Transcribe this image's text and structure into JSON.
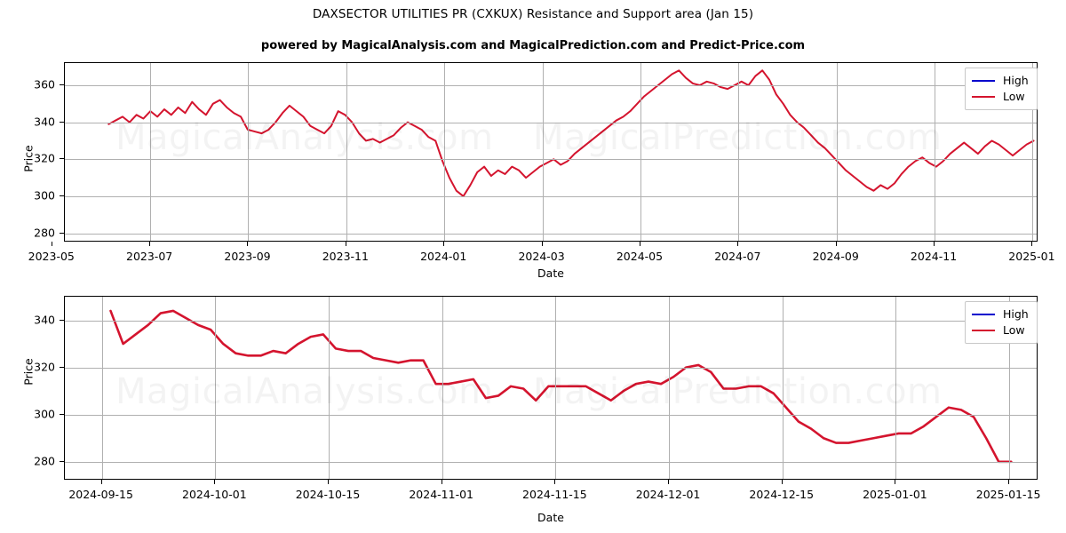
{
  "header": {
    "title": "DAXSECTOR UTILITIES PR (CXKUX) Resistance and Support area (Jan 15)",
    "subtitle": "powered by MagicalAnalysis.com and MagicalPrediction.com and Predict-Price.com"
  },
  "watermarks": [
    "MagicalAnalysis.com",
    "MagicalPrediction.com"
  ],
  "colors": {
    "high_series": "#0000cd",
    "low_series": "#d4142e",
    "grid": "#b0b0b0",
    "axis": "#000000",
    "background": "#ffffff"
  },
  "legend": {
    "position": "upper-right",
    "entries": [
      {
        "label": "High",
        "color": "#0000cd"
      },
      {
        "label": "Low",
        "color": "#d4142e"
      }
    ]
  },
  "chart_data": [
    {
      "id": "top-chart",
      "type": "line",
      "title": "",
      "xlabel": "Date",
      "ylabel": "Price",
      "grid": true,
      "legend_position": "upper-right",
      "xlim": [
        "2023-05-01",
        "2025-01-20"
      ],
      "ylim": [
        275,
        372
      ],
      "xticks": [
        "2023-05",
        "2023-07",
        "2023-09",
        "2023-11",
        "2024-01",
        "2024-03",
        "2024-05",
        "2024-07",
        "2024-09",
        "2024-11",
        "2025-01"
      ],
      "yticks": [
        280,
        300,
        320,
        340,
        360
      ],
      "series": [
        {
          "name": "High",
          "color": "#0000cd",
          "values": []
        },
        {
          "name": "Low",
          "color": "#d4142e",
          "x": [
            0.072,
            0.08,
            0.087,
            0.094,
            0.101,
            0.108,
            0.115,
            0.122,
            0.129,
            0.136,
            0.143,
            0.15,
            0.157,
            0.164,
            0.171,
            0.178,
            0.185,
            0.192,
            0.199,
            0.206,
            0.213,
            0.22,
            0.227,
            0.234,
            0.241,
            0.248,
            0.255,
            0.262,
            0.269,
            0.276,
            0.283,
            0.29,
            0.297,
            0.304,
            0.311,
            0.318,
            0.325,
            0.332,
            0.339,
            0.346,
            0.353,
            0.36,
            0.367,
            0.374,
            0.381,
            0.388,
            0.395,
            0.402,
            0.409,
            0.416,
            0.423,
            0.43,
            0.437,
            0.444,
            0.451,
            0.458,
            0.465,
            0.472,
            0.479,
            0.486,
            0.493,
            0.5,
            0.507,
            0.514,
            0.521,
            0.528,
            0.535,
            0.542,
            0.549,
            0.556,
            0.563,
            0.57,
            0.577,
            0.584,
            0.591,
            0.598,
            0.605,
            0.612,
            0.619,
            0.626,
            0.633,
            0.64,
            0.647,
            0.654,
            0.661,
            0.668,
            0.675,
            0.682,
            0.689,
            0.696,
            0.703,
            0.71,
            0.717,
            0.724,
            0.731,
            0.738,
            0.745,
            0.752,
            0.759,
            0.766,
            0.773,
            0.78,
            0.787,
            0.794,
            0.801,
            0.808,
            0.815,
            0.822,
            0.829,
            0.836,
            0.843,
            0.85,
            0.857,
            0.864,
            0.871,
            0.878,
            0.885,
            0.892,
            0.899,
            0.906,
            0.913,
            0.92,
            0.927,
            0.934,
            0.941,
            0.948,
            0.955,
            0.962,
            0.969,
            0.976,
            0.983,
            0.99,
            0.997
          ],
          "values": [
            339,
            341,
            343,
            340,
            344,
            342,
            346,
            343,
            347,
            344,
            348,
            345,
            351,
            347,
            344,
            350,
            352,
            348,
            345,
            343,
            336,
            335,
            334,
            336,
            340,
            345,
            349,
            346,
            343,
            338,
            336,
            334,
            338,
            346,
            344,
            340,
            334,
            330,
            331,
            329,
            331,
            333,
            337,
            340,
            338,
            336,
            332,
            330,
            319,
            310,
            303,
            300,
            306,
            313,
            316,
            311,
            314,
            312,
            316,
            314,
            310,
            313,
            316,
            318,
            320,
            317,
            319,
            323,
            326,
            329,
            332,
            335,
            338,
            341,
            343,
            346,
            350,
            354,
            357,
            360,
            363,
            366,
            368,
            364,
            361,
            360,
            362,
            361,
            359,
            358,
            360,
            362,
            360,
            365,
            368,
            363,
            355,
            350,
            344,
            340,
            337,
            333,
            329,
            326,
            322,
            318,
            314,
            311,
            308,
            305,
            303,
            306,
            304,
            307,
            312,
            316,
            319,
            321,
            318,
            316,
            319,
            323,
            326,
            329,
            326,
            323,
            327,
            330,
            328,
            325,
            322,
            325,
            328,
            330
          ]
        }
      ]
    },
    {
      "id": "bottom-chart",
      "type": "line",
      "title": "",
      "xlabel": "Date",
      "ylabel": "Price",
      "grid": true,
      "legend_position": "upper-right",
      "xlim": [
        "2024-09-10",
        "2025-01-18"
      ],
      "ylim": [
        272,
        350
      ],
      "xticks": [
        "2024-09-15",
        "2024-10-01",
        "2024-10-15",
        "2024-11-01",
        "2024-11-15",
        "2024-12-01",
        "2024-12-15",
        "2025-01-01",
        "2025-01-15"
      ],
      "yticks": [
        280,
        300,
        320,
        340
      ],
      "series": [
        {
          "name": "High",
          "color": "#0000cd",
          "values": []
        },
        {
          "name": "Low",
          "color": "#d4142e",
          "values": [
            344,
            330,
            334,
            338,
            343,
            344,
            341,
            338,
            336,
            330,
            326,
            325,
            325,
            327,
            326,
            330,
            333,
            334,
            328,
            327,
            327,
            324,
            323,
            322,
            323,
            323,
            313,
            313,
            314,
            315,
            307,
            308,
            312,
            311,
            306,
            312,
            312,
            312,
            312,
            309,
            306,
            310,
            313,
            314,
            313,
            316,
            320,
            321,
            318,
            311,
            311,
            312,
            312,
            309,
            303,
            297,
            294,
            290,
            288,
            288,
            289,
            290,
            291,
            292,
            292,
            295,
            299,
            303,
            302,
            299,
            290,
            280,
            280
          ]
        }
      ]
    }
  ]
}
